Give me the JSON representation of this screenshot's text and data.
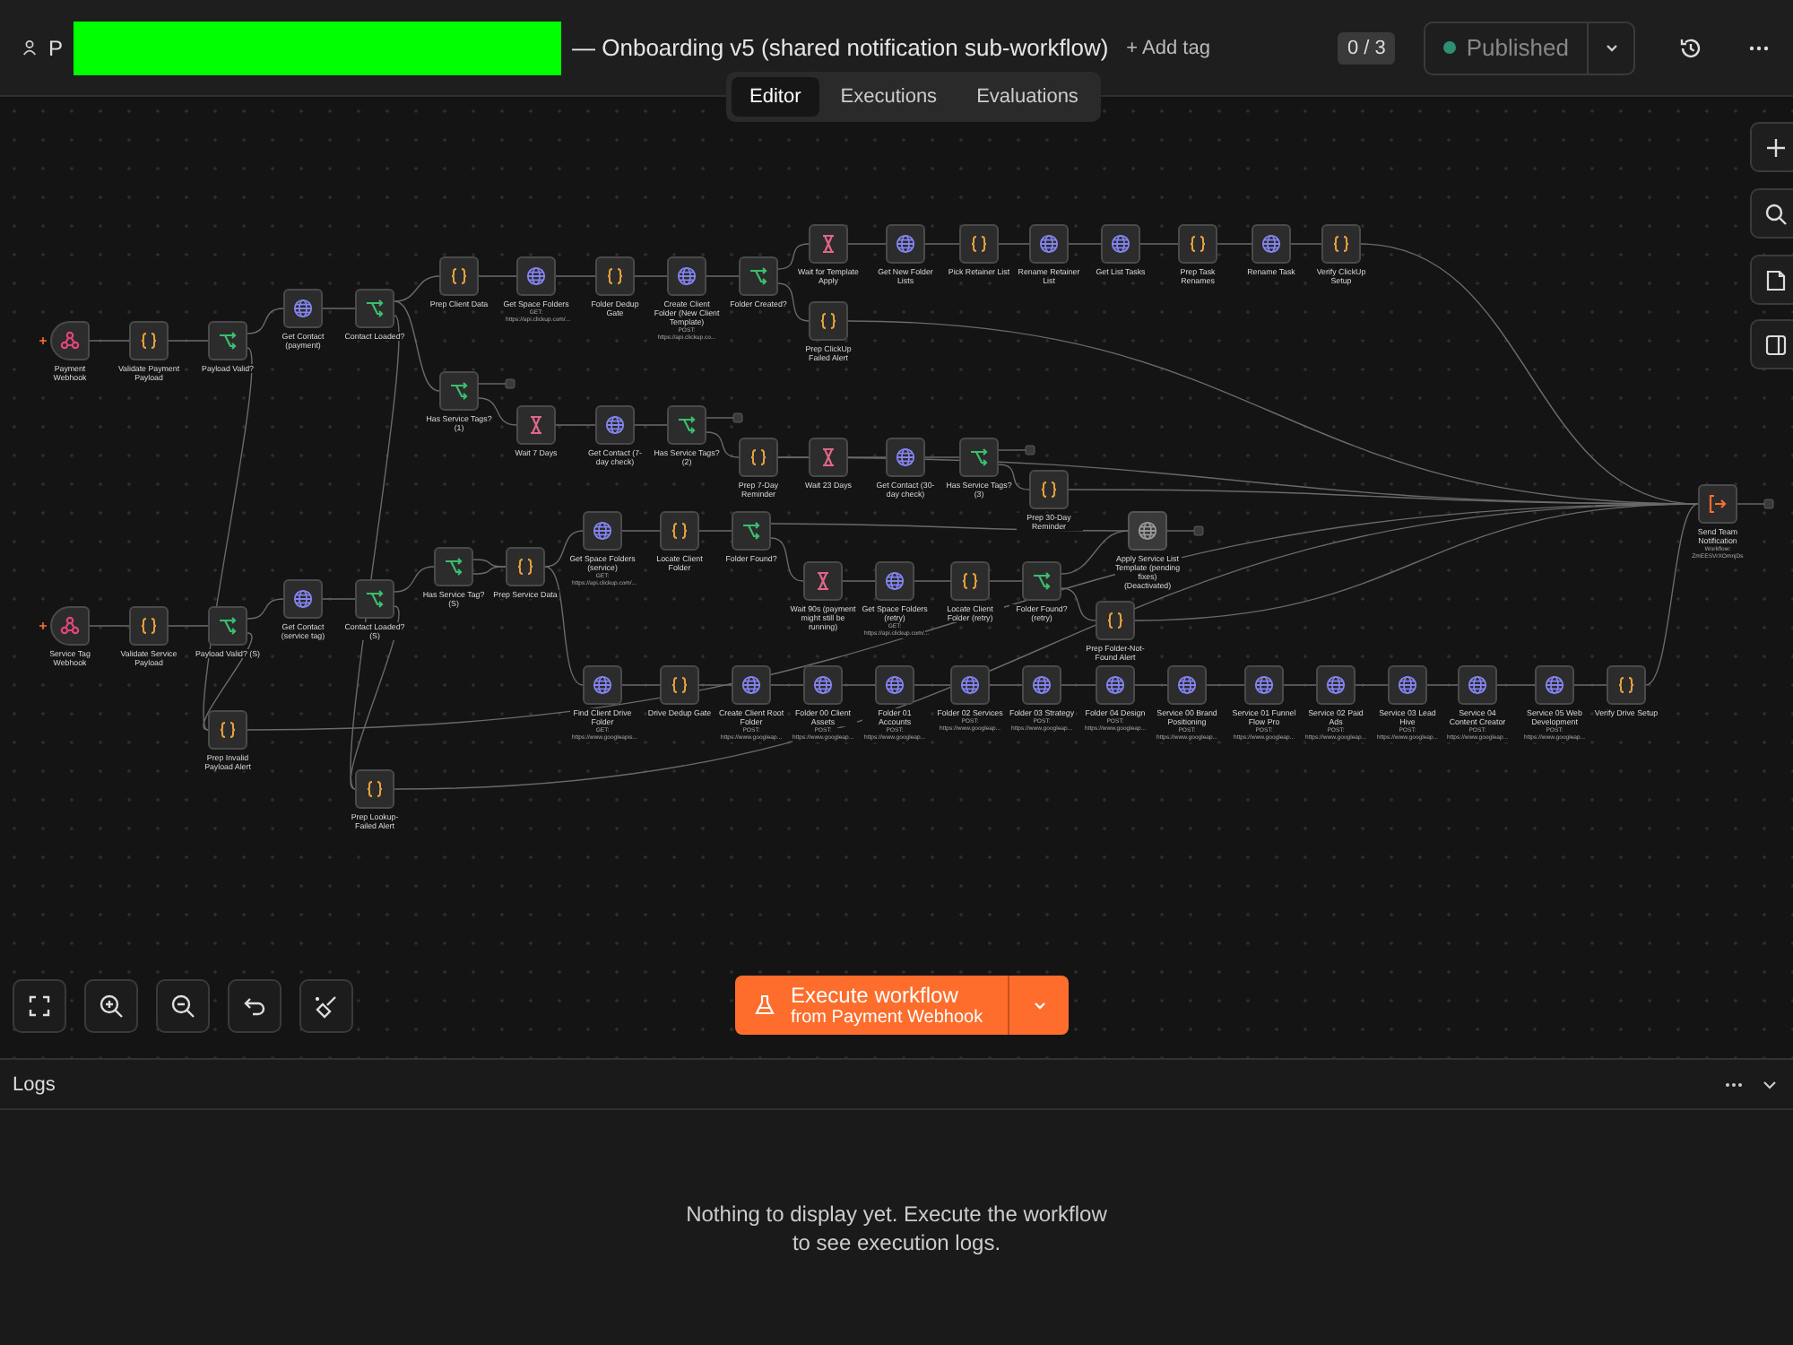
{
  "header": {
    "title_prefix": "P",
    "title": "— Onboarding v5 (shared notification sub-workflow)",
    "add_tag": "+ Add tag",
    "counter": "0 / 3",
    "publish_button": "Published"
  },
  "tabs": [
    {
      "label": "Editor",
      "selected": true
    },
    {
      "label": "Executions",
      "selected": false
    },
    {
      "label": "Evaluations",
      "selected": false
    }
  ],
  "nodes": [
    {
      "label": "Payment Webhook",
      "kind": "webhook",
      "deactivated": false
    },
    {
      "label": "Validate Payment Payload",
      "kind": "code",
      "deactivated": false
    },
    {
      "label": "Payload Valid?",
      "kind": "if",
      "deactivated": false
    },
    {
      "label": "Get Contact (payment)",
      "kind": "http",
      "deactivated": false
    },
    {
      "label": "Contact Loaded?",
      "kind": "if",
      "deactivated": false
    },
    {
      "label": "Prep Client Data",
      "kind": "code",
      "deactivated": false
    },
    {
      "label": "Get Space Folders",
      "kind": "http",
      "deactivated": false,
      "subtitle": "GET: https://api.clickup.com/..."
    },
    {
      "label": "Folder Dedup Gate",
      "kind": "code",
      "deactivated": false
    },
    {
      "label": "Create Client Folder (New Client Template)",
      "kind": "http",
      "deactivated": false,
      "subtitle": "POST: https://api.clickup.co..."
    },
    {
      "label": "Folder Created?",
      "kind": "if",
      "deactivated": false
    },
    {
      "label": "Wait for Template Apply",
      "kind": "wait",
      "deactivated": false
    },
    {
      "label": "Get New Folder Lists",
      "kind": "http",
      "deactivated": false
    },
    {
      "label": "Pick Retainer List",
      "kind": "code",
      "deactivated": false
    },
    {
      "label": "Rename Retainer List",
      "kind": "http",
      "deactivated": false
    },
    {
      "label": "Get List Tasks",
      "kind": "http",
      "deactivated": false
    },
    {
      "label": "Prep Task Renames",
      "kind": "code",
      "deactivated": false
    },
    {
      "label": "Rename Task",
      "kind": "http",
      "deactivated": false
    },
    {
      "label": "Verify ClickUp Setup",
      "kind": "code",
      "deactivated": false
    },
    {
      "label": "Prep ClickUp Failed Alert",
      "kind": "code",
      "deactivated": false
    },
    {
      "label": "Has Service Tags? (1)",
      "kind": "if",
      "deactivated": false
    },
    {
      "label": "Wait 7 Days",
      "kind": "wait",
      "deactivated": false
    },
    {
      "label": "Get Contact (7-day check)",
      "kind": "http",
      "deactivated": false
    },
    {
      "label": "Has Service Tags? (2)",
      "kind": "if",
      "deactivated": false
    },
    {
      "label": "Prep 7-Day Reminder",
      "kind": "code",
      "deactivated": false
    },
    {
      "label": "Wait 23 Days",
      "kind": "wait",
      "deactivated": false
    },
    {
      "label": "Get Contact (30-day check)",
      "kind": "http",
      "deactivated": false
    },
    {
      "label": "Has Service Tags? (3)",
      "kind": "if",
      "deactivated": false
    },
    {
      "label": "Prep 30-Day Reminder",
      "kind": "code",
      "deactivated": false
    },
    {
      "label": "Send Team Notification",
      "kind": "execute",
      "deactivated": false,
      "subtitle": "Workflow: ZmEESVrXOmnjDs"
    },
    {
      "label": "Service Tag Webhook",
      "kind": "webhook",
      "deactivated": false
    },
    {
      "label": "Validate Service Payload",
      "kind": "code",
      "deactivated": false
    },
    {
      "label": "Payload Valid? (S)",
      "kind": "if",
      "deactivated": false
    },
    {
      "label": "Get Contact (service tag)",
      "kind": "http",
      "deactivated": false
    },
    {
      "label": "Contact Loaded? (S)",
      "kind": "if",
      "deactivated": false
    },
    {
      "label": "Has Service Tag? (S)",
      "kind": "if",
      "deactivated": false
    },
    {
      "label": "Prep Service Data",
      "kind": "code",
      "deactivated": false
    },
    {
      "label": "Get Space Folders (service)",
      "kind": "http",
      "deactivated": false,
      "subtitle": "GET: https://api.clickup.com/..."
    },
    {
      "label": "Locate Client Folder",
      "kind": "code",
      "deactivated": false
    },
    {
      "label": "Folder Found?",
      "kind": "if",
      "deactivated": false
    },
    {
      "label": "Apply Service List Template (pending fixes) (Deactivated)",
      "kind": "http",
      "deactivated": true
    },
    {
      "label": "Wait 90s (payment might still be running)",
      "kind": "wait",
      "deactivated": false
    },
    {
      "label": "Get Space Folders (retry)",
      "kind": "http",
      "deactivated": false,
      "subtitle": "GET: https://api.clickup.com/..."
    },
    {
      "label": "Locate Client Folder (retry)",
      "kind": "code",
      "deactivated": false
    },
    {
      "label": "Folder Found? (retry)",
      "kind": "if",
      "deactivated": false
    },
    {
      "label": "Prep Folder-Not-Found Alert",
      "kind": "code",
      "deactivated": false
    },
    {
      "label": "Find Client Drive Folder",
      "kind": "http",
      "deactivated": false,
      "subtitle": "GET: https://www.googleapis..."
    },
    {
      "label": "Drive Dedup Gate",
      "kind": "code",
      "deactivated": false
    },
    {
      "label": "Create Client Root Folder",
      "kind": "http",
      "deactivated": false,
      "subtitle": "POST: https://www.googleap..."
    },
    {
      "label": "Folder 00 Client Assets",
      "kind": "http",
      "deactivated": false,
      "subtitle": "POST: https://www.googleap..."
    },
    {
      "label": "Folder 01 Accounts",
      "kind": "http",
      "deactivated": false,
      "subtitle": "POST: https://www.googleap..."
    },
    {
      "label": "Folder 02 Services",
      "kind": "http",
      "deactivated": false,
      "subtitle": "POST: https://www.googleap..."
    },
    {
      "label": "Folder 03 Strategy",
      "kind": "http",
      "deactivated": false,
      "subtitle": "POST: https://www.googleap..."
    },
    {
      "label": "Folder 04 Design",
      "kind": "http",
      "deactivated": false,
      "subtitle": "POST: https://www.googleap..."
    },
    {
      "label": "Service 00 Brand Positioning",
      "kind": "http",
      "deactivated": false,
      "subtitle": "POST: https://www.googleap..."
    },
    {
      "label": "Service 01 Funnel Flow Pro",
      "kind": "http",
      "deactivated": false,
      "subtitle": "POST: https://www.googleap..."
    },
    {
      "label": "Service 02 Paid Ads",
      "kind": "http",
      "deactivated": false,
      "subtitle": "POST: https://www.googleap..."
    },
    {
      "label": "Service 03 Lead Hive",
      "kind": "http",
      "deactivated": false,
      "subtitle": "POST: https://www.googleap..."
    },
    {
      "label": "Service 04 Content Creator",
      "kind": "http",
      "deactivated": false,
      "subtitle": "POST: https://www.googleap..."
    },
    {
      "label": "Service 05 Web Development",
      "kind": "http",
      "deactivated": false,
      "subtitle": "POST: https://www.googleap..."
    },
    {
      "label": "Verify Drive Setup",
      "kind": "code",
      "deactivated": false
    },
    {
      "label": "Prep Invalid Payload Alert",
      "kind": "code",
      "deactivated": false
    },
    {
      "label": "Prep Lookup-Failed Alert",
      "kind": "code",
      "deactivated": false
    }
  ],
  "execute_button": {
    "label": "Execute workflow",
    "sublabel": "from Payment Webhook"
  },
  "logs": {
    "title": "Logs",
    "empty_message": "Nothing to display yet. Execute the workflow to see execution logs."
  }
}
